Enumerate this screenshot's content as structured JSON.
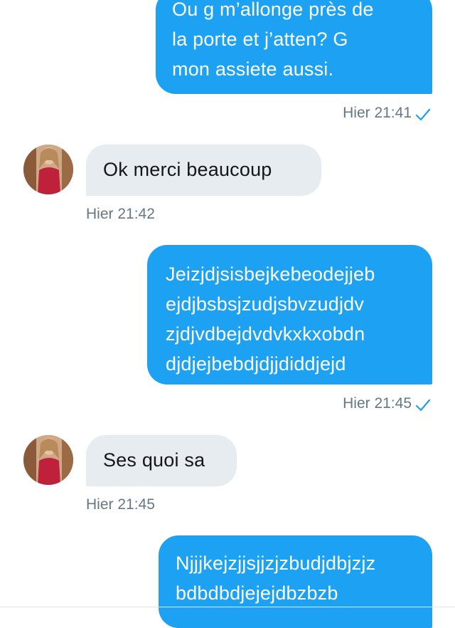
{
  "conversation": {
    "messages": [
      {
        "side": "sent",
        "lines": [
          "Ou g m’allonge près de",
          "la porte et j’atten? G",
          "mon assiete aussi."
        ],
        "timestamp": "Hier 21:41"
      },
      {
        "side": "received",
        "lines": [
          "Ok merci beaucoup"
        ],
        "timestamp": "Hier 21:42"
      },
      {
        "side": "sent",
        "lines": [
          "Jeizjdjsisbejkebeodejjeb",
          "ejdjbsbsjzudjsbvzudjdv",
          "zjdjvdbejdvdvkxkxobdn",
          "djdjejbebdjdjjdiddjejd"
        ],
        "timestamp": "Hier 21:45"
      },
      {
        "side": "received",
        "lines": [
          "Ses quoi sa"
        ],
        "timestamp": "Hier 21:45"
      },
      {
        "side": "sent",
        "lines": [
          "Njjjkejzjjsjjzjzbudjdbjzjz",
          "bdbdbdjejejdbzbzb"
        ],
        "timestamp": ""
      }
    ]
  },
  "icons": {
    "read_receipt": "checkmark-icon",
    "avatar": "contact-avatar"
  },
  "colors": {
    "sent_bubble": "#1DA1F2",
    "received_bubble": "#E6ECF0",
    "timestamp_text": "#657786",
    "read_check": "#1DA1F2"
  }
}
